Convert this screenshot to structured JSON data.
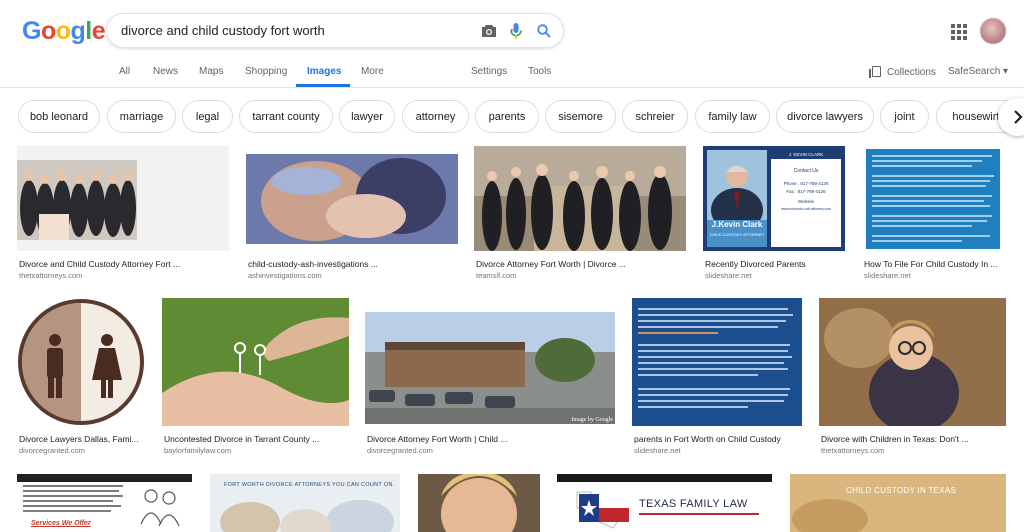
{
  "logo": {
    "letters": [
      "G",
      "o",
      "o",
      "g",
      "l",
      "e"
    ],
    "colors": [
      "#4285f4",
      "#ea4335",
      "#fbbc05",
      "#4285f4",
      "#34a853",
      "#ea4335"
    ]
  },
  "search": {
    "query": "divorce and child custody fort worth"
  },
  "icons": {
    "camera": "camera-icon",
    "mic": "microphone-icon",
    "search": "search-icon",
    "apps": "apps-grid-icon",
    "next": "chevron-right-icon",
    "collections": "collections-icon"
  },
  "nav": {
    "all": "All",
    "news": "News",
    "maps": "Maps",
    "shopping": "Shopping",
    "images": "Images",
    "more": "More",
    "settings": "Settings",
    "tools": "Tools",
    "collections": "Collections",
    "safesearch": "SafeSearch ▾"
  },
  "chips": [
    "bob leonard",
    "marriage",
    "legal",
    "tarrant county",
    "lawyer",
    "attorney",
    "parents",
    "sisemore",
    "schreier",
    "family law",
    "divorce lawyers",
    "joint",
    "housewirth"
  ],
  "results": [
    {
      "caption": "Divorce and Child Custody Attorney Fort ...",
      "source": "thetxattorneys.com"
    },
    {
      "caption": "child-custody-ash-investigations ...",
      "source": "ashinvestigations.com"
    },
    {
      "caption": "Divorce Attorney Fort Worth | Divorce ...",
      "source": "teamslf.com"
    },
    {
      "caption": "Recently Divorced Parents",
      "source": "slideshare.net",
      "card": {
        "header": "J. KEVIN CLARK",
        "contact": "Contact Us",
        "phone": "Phone : 817-789-4126",
        "fax": "Fax : 817-789-4126",
        "website_label": "Website",
        "website": "www.fortworth-civil-attorney.com",
        "name": "J.Kevin Clark",
        "title": "CHILD CUSTODY ATTORNEY"
      }
    },
    {
      "caption": "How To File For Child Custody In ...",
      "source": "slideshare.net"
    },
    {
      "caption": "Divorce Lawyers Dallas, Fami...",
      "source": "divorcegranted.com"
    },
    {
      "caption": "Uncontested Divorce in Tarrant County ...",
      "source": "baylorfamilylaw.com"
    },
    {
      "caption": "Divorce Attorney Fort Worth | Child ...",
      "source": "divorcegranted.com",
      "watermark": "Image by Google"
    },
    {
      "caption": "parents in Fort Worth on Child Custody",
      "source": "slideshare.net"
    },
    {
      "caption": "Divorce with Children in Texas: Don't ...",
      "source": "thetxattorneys.com"
    }
  ],
  "row3": {
    "services": "Services We Offer",
    "banner": "FORT WORTH DIVORCE ATTORNEYS YOU CAN COUNT ON.",
    "texas": "TEXAS FAMILY LAW",
    "custody": "CHILD CUSTODY IN TEXAS"
  }
}
